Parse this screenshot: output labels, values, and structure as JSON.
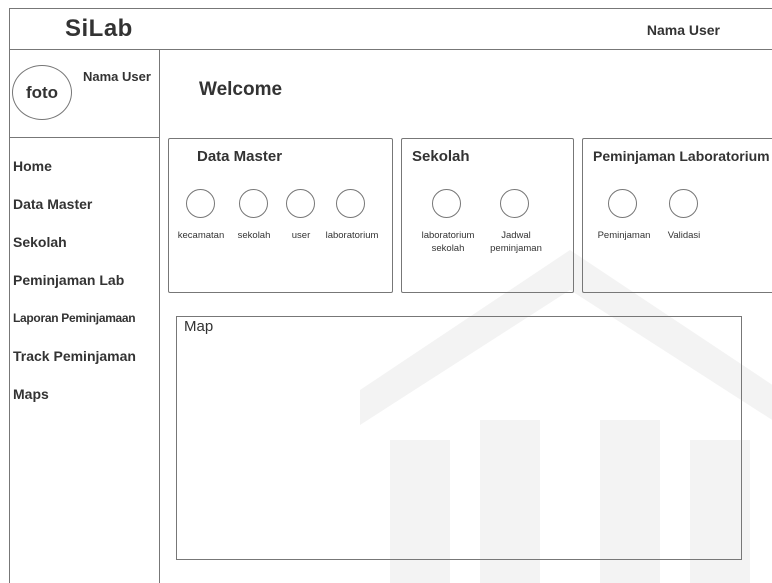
{
  "header": {
    "brand": "SiLab",
    "user_name": "Nama User"
  },
  "sidebar": {
    "avatar_label": "foto",
    "profile_name": "Nama User",
    "items": [
      {
        "label": "Home"
      },
      {
        "label": "Data Master"
      },
      {
        "label": "Sekolah"
      },
      {
        "label": "Peminjaman Lab"
      },
      {
        "label": "Laporan Peminjamaan"
      },
      {
        "label": "Track Peminjaman"
      },
      {
        "label": "Maps"
      }
    ]
  },
  "main": {
    "welcome": "Welcome",
    "cards": [
      {
        "title": "Data Master",
        "buttons": [
          {
            "label": "kecamatan"
          },
          {
            "label": "sekolah"
          },
          {
            "label": "user"
          },
          {
            "label": "laboratorium"
          }
        ]
      },
      {
        "title": "Sekolah",
        "buttons": [
          {
            "label": "laboratorium\nsekolah"
          },
          {
            "label": "Jadwal\npeminjaman"
          }
        ]
      },
      {
        "title": "Peminjaman Laboratorium",
        "buttons": [
          {
            "label": "Peminjaman"
          },
          {
            "label": "Validasi"
          }
        ]
      }
    ],
    "map": {
      "title": "Map"
    }
  },
  "colors": {
    "border": "#777777",
    "text": "#333333",
    "watermark": "#f2f2f2"
  }
}
